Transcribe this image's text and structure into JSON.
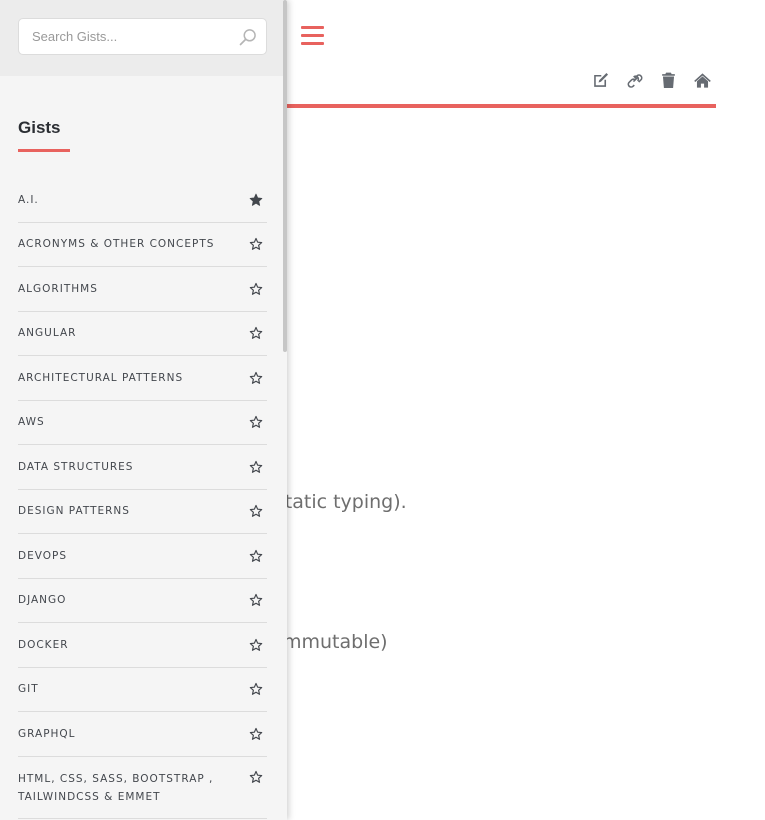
{
  "search": {
    "placeholder": "Search Gists..."
  },
  "sidebar": {
    "title": "Gists",
    "items": [
      {
        "label": "A.I.",
        "starred": true
      },
      {
        "label": "ACRONYMS & OTHER CONCEPTS",
        "starred": false
      },
      {
        "label": "ALGORITHMS",
        "starred": false
      },
      {
        "label": "ANGULAR",
        "starred": false
      },
      {
        "label": "ARCHITECTURAL PATTERNS",
        "starred": false
      },
      {
        "label": "AWS",
        "starred": false
      },
      {
        "label": "DATA STRUCTURES",
        "starred": false
      },
      {
        "label": "DESIGN PATTERNS",
        "starred": false
      },
      {
        "label": "DEVOPS",
        "starred": false
      },
      {
        "label": "DJANGO",
        "starred": false
      },
      {
        "label": "DOCKER",
        "starred": false
      },
      {
        "label": "GIT",
        "starred": false
      },
      {
        "label": "GRAPHQL",
        "starred": false
      },
      {
        "label": "HTML, CSS, SASS, BOOTSTRAP ,\nTAILWINDCSS & EMMET",
        "starred": false
      }
    ]
  },
  "toolbar": {
    "icons": [
      "edit-icon",
      "link-icon",
      "trash-icon",
      "home-icon"
    ]
  },
  "content": {
    "fragment_1": "ed to static typing).",
    "fragment_2": "nods, immutable)"
  },
  "colors": {
    "accent": "#e8625e",
    "sidebar_bg": "#f5f5f5",
    "icon": "#666b72",
    "text_dark": "#2b2e33"
  }
}
